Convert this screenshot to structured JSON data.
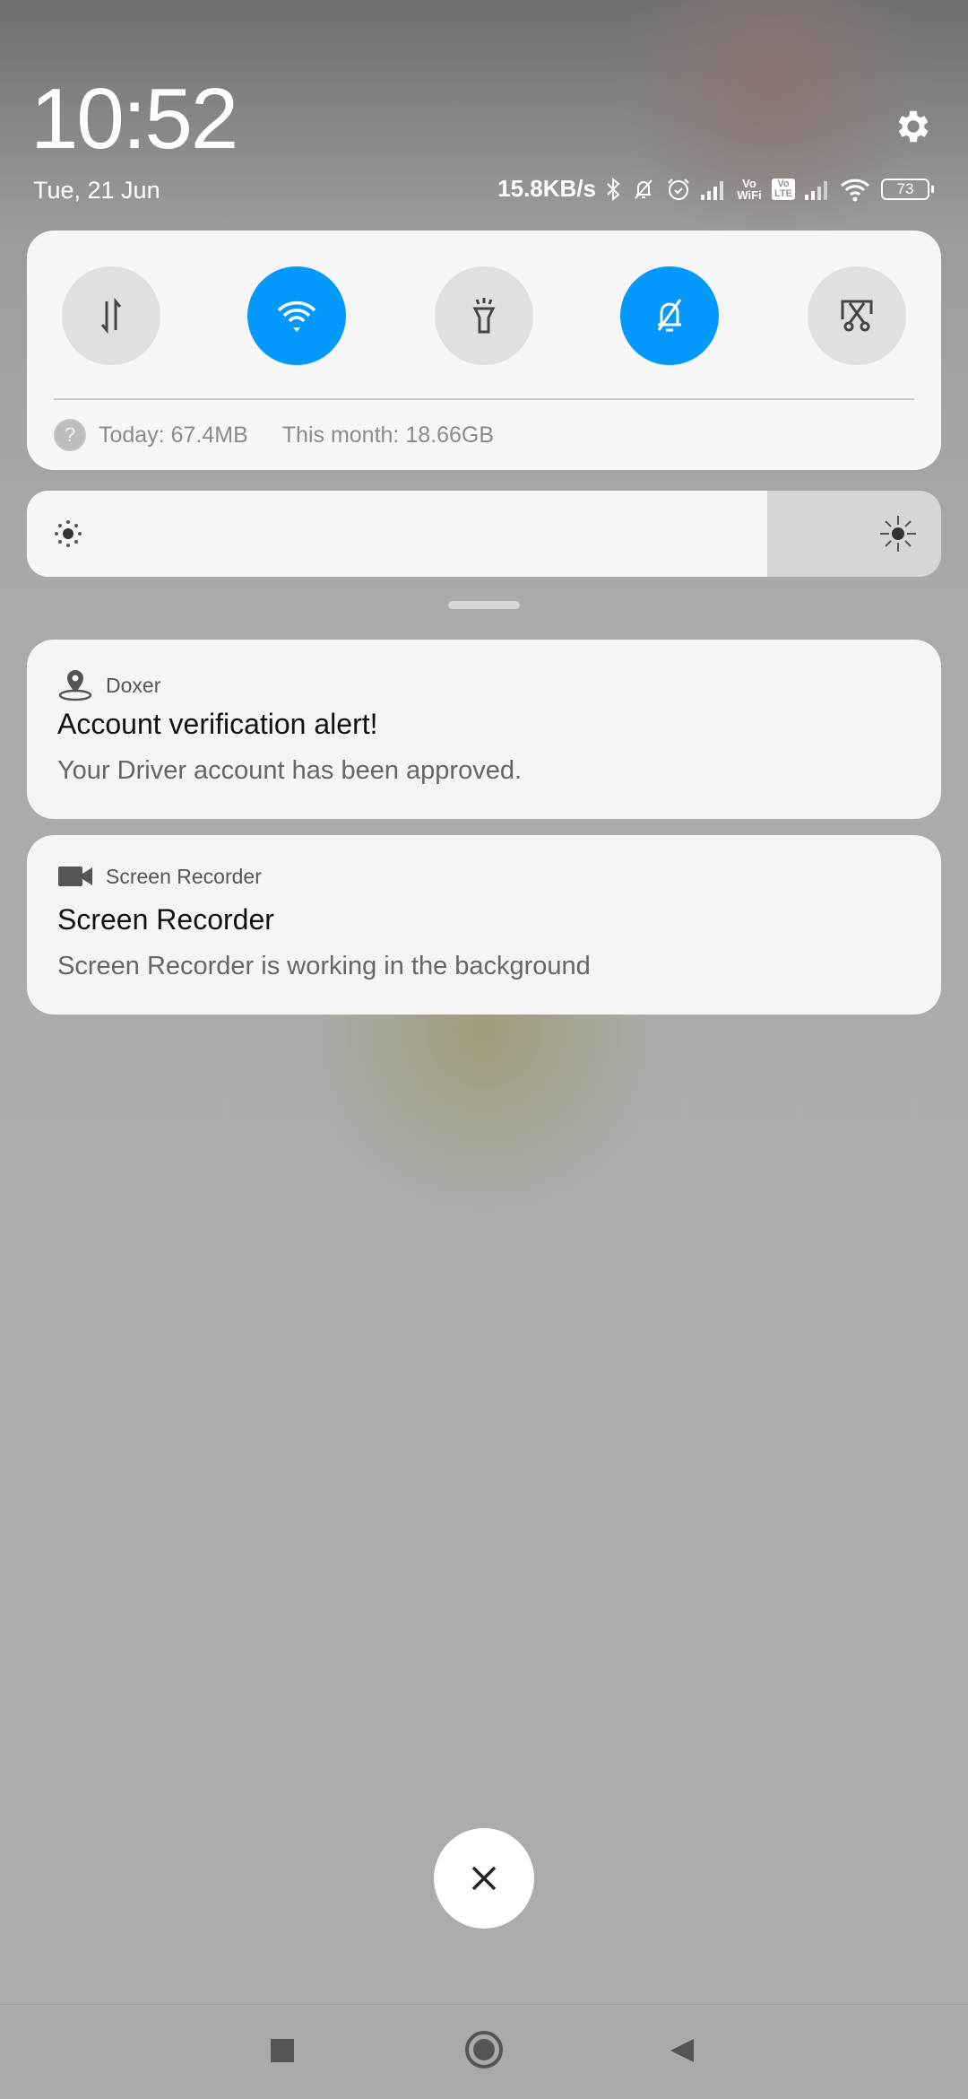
{
  "status_bar": {
    "time": "10:52",
    "date": "Tue, 21 Jun",
    "net_speed": "15.8KB/s",
    "vo_wifi": "Vo WiFi",
    "volte": "Vo LTE",
    "battery": "73"
  },
  "quick_settings": {
    "toggles": [
      {
        "name": "mobile-data",
        "on": false
      },
      {
        "name": "wifi",
        "on": true
      },
      {
        "name": "flashlight",
        "on": false
      },
      {
        "name": "silent",
        "on": true
      },
      {
        "name": "screenshot",
        "on": false
      }
    ],
    "usage_today": "Today: 67.4MB",
    "usage_month": "This month: 18.66GB",
    "brightness_percent": 81
  },
  "notifications": [
    {
      "app": "Doxer",
      "title": "Account verification alert!",
      "body": "Your Driver account has been approved."
    },
    {
      "app": "Screen Recorder",
      "title": "Screen Recorder",
      "body": "Screen Recorder is working in the background"
    }
  ],
  "colors": {
    "accent": "#0399fc"
  }
}
